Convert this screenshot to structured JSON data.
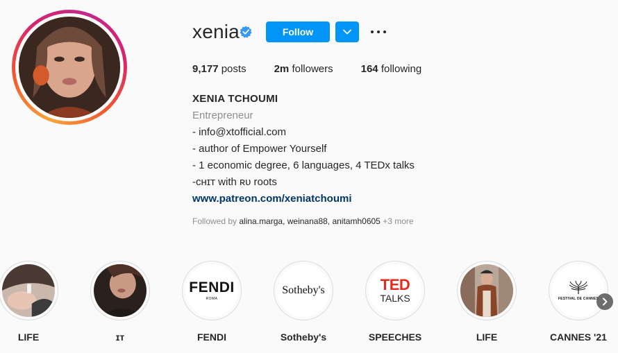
{
  "profile": {
    "username": "xenia",
    "verified": true,
    "follow_label": "Follow",
    "stats": {
      "posts_count": "9,177",
      "posts_label": "posts",
      "followers_count": "2m",
      "followers_label": "followers",
      "following_count": "164",
      "following_label": "following"
    },
    "bio": {
      "full_name": "XENIA TCHOUMI",
      "category": "Entrepreneur",
      "lines": [
        "- info@xtofficial.com",
        "- author of Empower Yourself",
        "- 1 economic degree, 6 languages, 4 TEDx talks",
        "-ᴄʜɪᴛ with ʀᴜ roots"
      ],
      "link": "www.patreon.com/xeniatchoumi"
    },
    "followed_by": {
      "prefix": "Followed by",
      "names": "alina.marga, weinana88, anitamh0605",
      "more": "+3 more"
    }
  },
  "highlights": [
    {
      "label": "LIFE",
      "cover": "photo"
    },
    {
      "label": "ɪᴛ",
      "cover": "photo"
    },
    {
      "label": "FENDI",
      "cover": "fendi-logo",
      "logo_text": "FENDI",
      "logo_sub": "ROMA"
    },
    {
      "label": "Sotheby's",
      "cover": "sothebys-logo",
      "logo_text": "Sotheby's"
    },
    {
      "label": "SPEECHES",
      "cover": "ted-logo",
      "logo_text": "TED",
      "logo_sub": "TALKS"
    },
    {
      "label": "LIFE",
      "cover": "photo"
    },
    {
      "label": "CANNES '21",
      "cover": "cannes-logo",
      "logo_text": "FESTIVAL DE CANNES"
    }
  ],
  "colors": {
    "accent": "#0095f6",
    "link": "#00376b",
    "muted": "#8e8e8e",
    "ted_red": "#e62b1e"
  }
}
